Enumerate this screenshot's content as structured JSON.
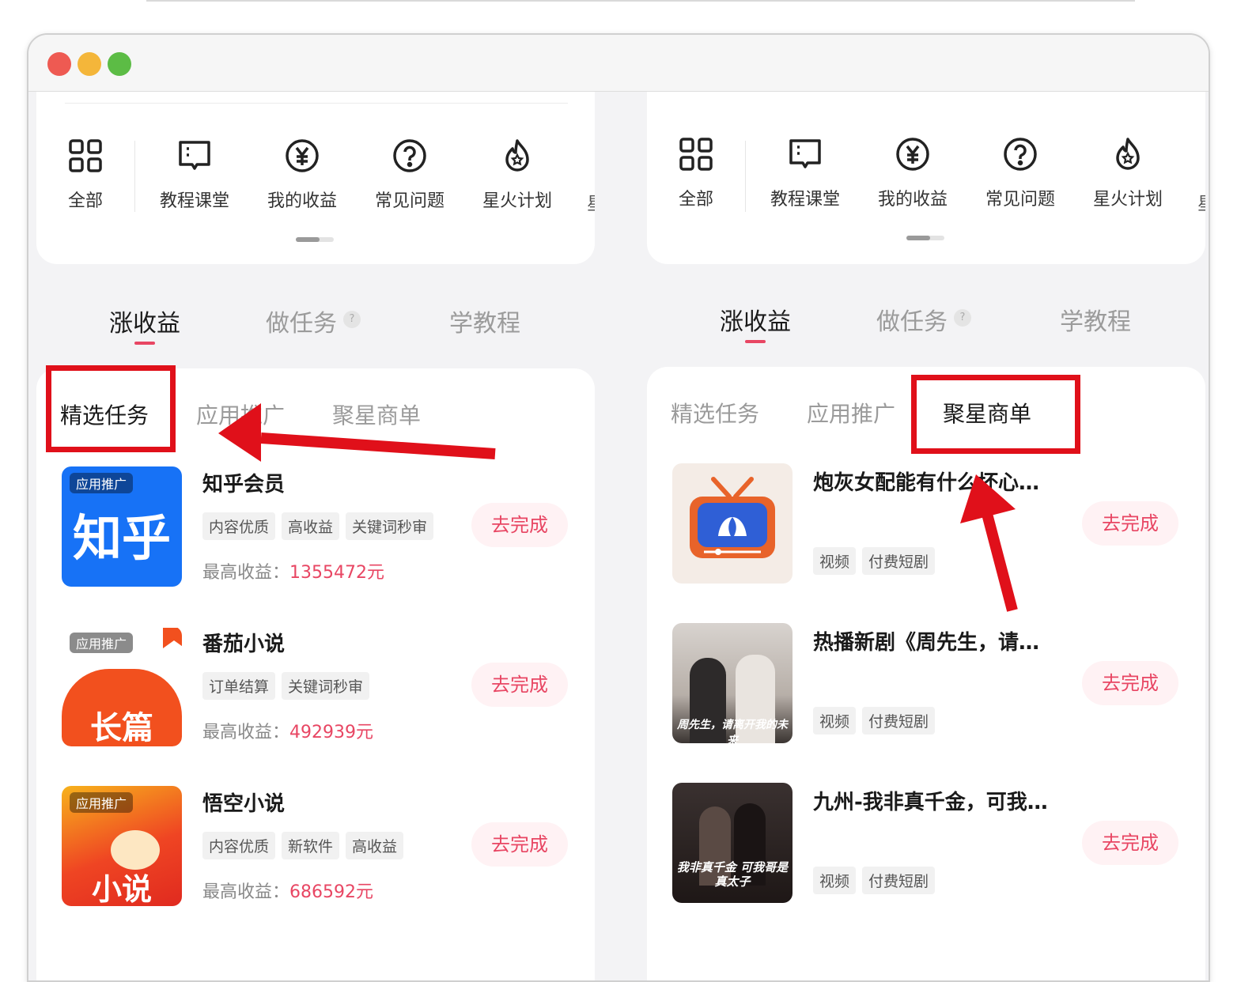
{
  "shortcuts": [
    {
      "label": "全部",
      "icon": "grid-icon"
    },
    {
      "label": "教程课堂",
      "icon": "book-icon"
    },
    {
      "label": "我的收益",
      "icon": "yen-coin-icon"
    },
    {
      "label": "常见问题",
      "icon": "question-circle-icon"
    },
    {
      "label": "星火计划",
      "icon": "flame-star-icon"
    }
  ],
  "main_tabs": [
    {
      "label": "涨收益",
      "active": true
    },
    {
      "label": "做任务",
      "help": "?"
    },
    {
      "label": "学教程"
    }
  ],
  "sub_tabs": [
    "精选任务",
    "应用推广",
    "聚星商单"
  ],
  "left_pane": {
    "active_sub_tab": "精选任务",
    "items": [
      {
        "badge": "应用推广",
        "thumb_text": "知乎",
        "title": "知乎会员",
        "tags": [
          "内容优质",
          "高收益",
          "关键词秒审"
        ],
        "earn_label": "最高收益：",
        "earn_value": "1355472元",
        "button": "去完成"
      },
      {
        "badge": "应用推广",
        "thumb_text": "长篇",
        "title": "番茄小说",
        "tags": [
          "订单结算",
          "关键词秒审"
        ],
        "earn_label": "最高收益：",
        "earn_value": "492939元",
        "button": "去完成"
      },
      {
        "badge": "应用推广",
        "thumb_text": "小说",
        "title": "悟空小说",
        "tags": [
          "内容优质",
          "新软件",
          "高收益"
        ],
        "earn_label": "最高收益：",
        "earn_value": "686592元",
        "button": "去完成"
      }
    ]
  },
  "right_pane": {
    "active_sub_tab": "聚星商单",
    "items": [
      {
        "title": "炮灰女配能有什么坏心…",
        "tags": [
          "视频",
          "付费短剧"
        ],
        "button": "去完成"
      },
      {
        "title": "热播新剧《周先生，请…",
        "tags": [
          "视频",
          "付费短剧"
        ],
        "button": "去完成",
        "poster_text": "周先生，请离开我的未来"
      },
      {
        "title": "九州-我非真千金，可我…",
        "tags": [
          "视频",
          "付费短剧"
        ],
        "button": "去完成",
        "poster_text": "我非真千金 可我哥是真太子"
      }
    ]
  },
  "colors": {
    "accent": "#e84663",
    "annotation_red": "#e0101a"
  }
}
